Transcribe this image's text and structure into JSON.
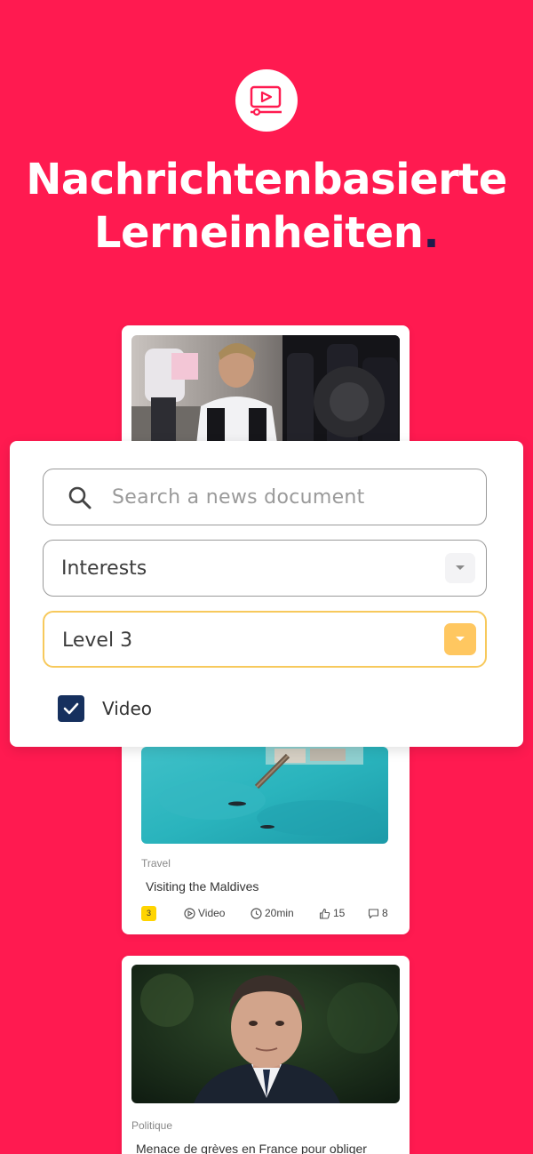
{
  "headline": {
    "line1": "Nachrichtenbasierte",
    "line2": "Lerneinheiten",
    "dot": "."
  },
  "filters": {
    "search_placeholder": "Search a news document",
    "interests_value": "Interests",
    "level_value": "Level 3",
    "video_label": "Video",
    "video_checked": true
  },
  "cards": [
    {
      "image": "racing-driver-photo"
    },
    {
      "image": "maldives-aerial-photo",
      "category": "Travel",
      "title": "Visiting the Maldives",
      "level": "3",
      "format": "Video",
      "duration": "20min",
      "likes": "15",
      "comments": "8"
    },
    {
      "image": "politician-portrait-photo",
      "category": "Politique",
      "title": "Menace de grèves en France pour obliger"
    }
  ],
  "colors": {
    "background": "#FF1A50",
    "accent_dark": "#1E1B4B",
    "level_highlight": "#F7C95C",
    "level_badge": "#FFD400",
    "checkbox": "#16305E"
  }
}
